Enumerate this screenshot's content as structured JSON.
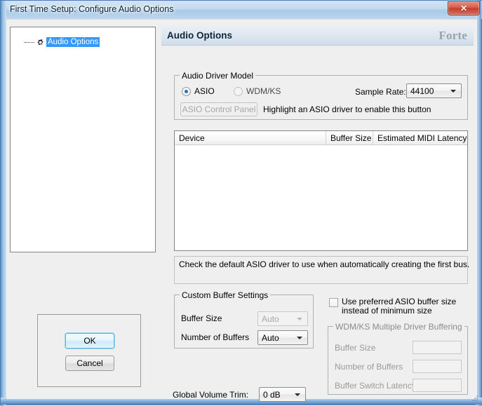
{
  "window": {
    "title": "First Time Setup:  Configure Audio Options",
    "close_glyph": "✕",
    "accent_blue": "#4a7fb5",
    "close_red": "#c43f2d"
  },
  "tree": {
    "items": [
      {
        "label": "Audio Options",
        "icon": "gear-icon",
        "selected": true,
        "selection_color": "#3399ff"
      }
    ]
  },
  "dialog_buttons": {
    "ok_label": "OK",
    "cancel_label": "Cancel"
  },
  "content": {
    "header_title": "Audio Options",
    "brand": "Forte"
  },
  "driver_group": {
    "legend": "Audio Driver Model",
    "radio_asio_label": "ASIO",
    "radio_wdmks_label": "WDM/KS",
    "selected": "ASIO",
    "sample_rate_label": "Sample Rate:",
    "sample_rate_value": "44100",
    "asio_control_panel_label": "ASIO Control Panel",
    "asio_control_panel_enabled": false,
    "asio_hint": "Highlight an ASIO driver to enable this button"
  },
  "device_list": {
    "columns": [
      "Device",
      "Buffer Size",
      "Estimated MIDI Latency"
    ],
    "rows": []
  },
  "info_box": {
    "text": "Check the default ASIO driver to use when automatically creating the first bus."
  },
  "custom_buffer": {
    "legend": "Custom Buffer Settings",
    "buffer_size_label": "Buffer Size",
    "buffer_size_value": "Auto",
    "buffer_size_enabled": false,
    "num_buffers_label": "Number of Buffers",
    "num_buffers_value": "Auto",
    "num_buffers_enabled": true
  },
  "use_preferred": {
    "label": "Use preferred ASIO buffer size instead of minimum size",
    "checked": false
  },
  "wdm_group": {
    "legend": "WDM/KS Multiple Driver Buffering",
    "enabled": false,
    "buffer_size_label": "Buffer Size",
    "buffer_size_value": "",
    "num_buffers_label": "Number of Buffers",
    "num_buffers_value": "",
    "latency_label": "Buffer Switch Latency",
    "latency_value": ""
  },
  "global_trim": {
    "label": "Global Volume Trim:",
    "value": "0 dB"
  }
}
